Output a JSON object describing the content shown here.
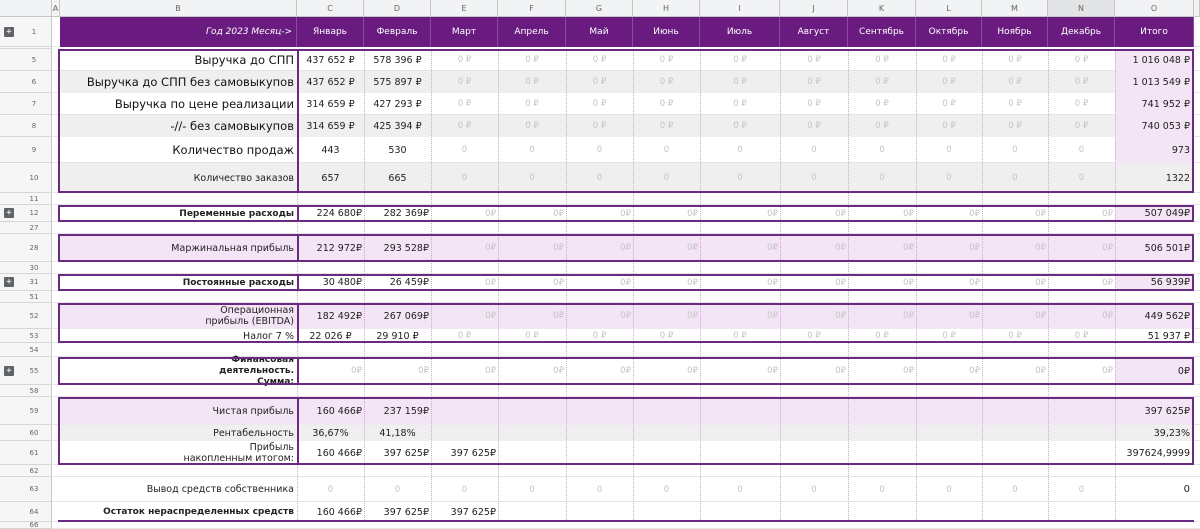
{
  "columns": [
    {
      "letter": "A"
    },
    {
      "letter": "B"
    },
    {
      "letter": "C"
    },
    {
      "letter": "D"
    },
    {
      "letter": "E"
    },
    {
      "letter": "F"
    },
    {
      "letter": "G"
    },
    {
      "letter": "H"
    },
    {
      "letter": "I"
    },
    {
      "letter": "J"
    },
    {
      "letter": "K"
    },
    {
      "letter": "L"
    },
    {
      "letter": "M"
    },
    {
      "letter": "N"
    },
    {
      "letter": "O"
    }
  ],
  "header_row": {
    "row_number": "1",
    "title": "Год 2023 Месяц->",
    "months": [
      "Январь",
      "Февраль",
      "Март",
      "Апрель",
      "Май",
      "Июнь",
      "Июль",
      "Август",
      "Сентябрь",
      "Октябрь",
      "Ноябрь",
      "Декабрь"
    ],
    "total": "Итого"
  },
  "rows": [
    {
      "row": "5",
      "label": "Выручка до СПП",
      "values": [
        "437 652 ₽",
        "578 396 ₽",
        "0 ₽",
        "0 ₽",
        "0 ₽",
        "0 ₽",
        "0 ₽",
        "0 ₽",
        "0 ₽",
        "0 ₽",
        "0 ₽",
        "0 ₽"
      ],
      "total": "1 016 048 ₽"
    },
    {
      "row": "6",
      "label": "Выручка до СПП без самовыкупов",
      "values": [
        "437 652 ₽",
        "575 897 ₽",
        "0 ₽",
        "0 ₽",
        "0 ₽",
        "0 ₽",
        "0 ₽",
        "0 ₽",
        "0 ₽",
        "0 ₽",
        "0 ₽",
        "0 ₽"
      ],
      "total": "1 013 549 ₽"
    },
    {
      "row": "7",
      "label": "Выручка по цене реализации",
      "values": [
        "314 659 ₽",
        "427 293 ₽",
        "0 ₽",
        "0 ₽",
        "0 ₽",
        "0 ₽",
        "0 ₽",
        "0 ₽",
        "0 ₽",
        "0 ₽",
        "0 ₽",
        "0 ₽"
      ],
      "total": "741 952 ₽"
    },
    {
      "row": "8",
      "label": "-//- без самовыкупов",
      "values": [
        "314 659 ₽",
        "425 394 ₽",
        "0 ₽",
        "0 ₽",
        "0 ₽",
        "0 ₽",
        "0 ₽",
        "0 ₽",
        "0 ₽",
        "0 ₽",
        "0 ₽",
        "0 ₽"
      ],
      "total": "740 053 ₽"
    },
    {
      "row": "9",
      "label": "Количество продаж",
      "values": [
        "443",
        "530",
        "0",
        "0",
        "0",
        "0",
        "0",
        "0",
        "0",
        "0",
        "0",
        "0"
      ],
      "total": "973"
    },
    {
      "row": "10",
      "label": "Количество заказов",
      "values": [
        "657",
        "665",
        "0",
        "0",
        "0",
        "0",
        "0",
        "0",
        "0",
        "0",
        "0",
        "0"
      ],
      "total": "1322"
    },
    {
      "row": "11"
    },
    {
      "row": "12",
      "label": "Переменные расходы",
      "values": [
        "224 680₽",
        "282 369₽",
        "0₽",
        "0₽",
        "0₽",
        "0₽",
        "0₽",
        "0₽",
        "0₽",
        "0₽",
        "0₽",
        "0₽"
      ],
      "total": "507 049₽"
    },
    {
      "row": "27"
    },
    {
      "row": "28",
      "label": "Маржинальная прибыль",
      "values": [
        "212 972₽",
        "293 528₽",
        "0₽",
        "0₽",
        "0₽",
        "0₽",
        "0₽",
        "0₽",
        "0₽",
        "0₽",
        "0₽",
        "0₽"
      ],
      "total": "506 501₽"
    },
    {
      "row": "30"
    },
    {
      "row": "31",
      "label": "Постоянные расходы",
      "values": [
        "30 480₽",
        "26 459₽",
        "0₽",
        "0₽",
        "0₽",
        "0₽",
        "0₽",
        "0₽",
        "0₽",
        "0₽",
        "0₽",
        "0₽"
      ],
      "total": "56 939₽"
    },
    {
      "row": "51"
    },
    {
      "row": "52",
      "label": "Операционная прибыль (EBITDA)",
      "values": [
        "182 492₽",
        "267 069₽",
        "0₽",
        "0₽",
        "0₽",
        "0₽",
        "0₽",
        "0₽",
        "0₽",
        "0₽",
        "0₽",
        "0₽"
      ],
      "total": "449 562₽"
    },
    {
      "row": "53",
      "label": "Налог 7 %",
      "values": [
        "22 026 ₽",
        "29 910 ₽",
        "0 ₽",
        "0 ₽",
        "0 ₽",
        "0 ₽",
        "0 ₽",
        "0 ₽",
        "0 ₽",
        "0 ₽",
        "0 ₽",
        "0 ₽"
      ],
      "total": "51 937 ₽"
    },
    {
      "row": "54"
    },
    {
      "row": "55",
      "label": "Финансовая деятельность. Сумма:",
      "values": [
        "0₽",
        "0₽",
        "0₽",
        "0₽",
        "0₽",
        "0₽",
        "0₽",
        "0₽",
        "0₽",
        "0₽",
        "0₽",
        "0₽"
      ],
      "total": "0₽"
    },
    {
      "row": "58"
    },
    {
      "row": "59",
      "label": "Чистая прибыль",
      "values": [
        "160 466₽",
        "237 159₽",
        "",
        "",
        "",
        "",
        "",
        "",
        "",
        "",
        "",
        ""
      ],
      "total": "397 625₽"
    },
    {
      "row": "60",
      "label": "Рентабельность",
      "values": [
        "36,67%",
        "41,18%",
        "",
        "",
        "",
        "",
        "",
        "",
        "",
        "",
        "",
        ""
      ],
      "total": "39,23%"
    },
    {
      "row": "61",
      "label": "Прибыль накопленным итогом:",
      "values": [
        "160 466₽",
        "397 625₽",
        "397 625₽",
        "",
        "",
        "",
        "",
        "",
        "",
        "",
        "",
        ""
      ],
      "total": "397624,9999"
    },
    {
      "row": "62"
    },
    {
      "row": "63",
      "label": "Вывод средств собственника",
      "values": [
        "0",
        "0",
        "0",
        "0",
        "0",
        "0",
        "0",
        "0",
        "0",
        "0",
        "0",
        "0"
      ],
      "total": "0"
    },
    {
      "row": "64",
      "label": "Остаток нераспределенных средств",
      "values": [
        "160 466₽",
        "397 625₽",
        "397 625₽",
        "",
        "",
        "",
        "",
        "",
        "",
        "",
        "",
        ""
      ],
      "total": ""
    },
    {
      "row": "66"
    }
  ],
  "colors": {
    "accent": "#6a1b7f",
    "lilac": "#f3e5f5",
    "gray": "#efefef"
  }
}
